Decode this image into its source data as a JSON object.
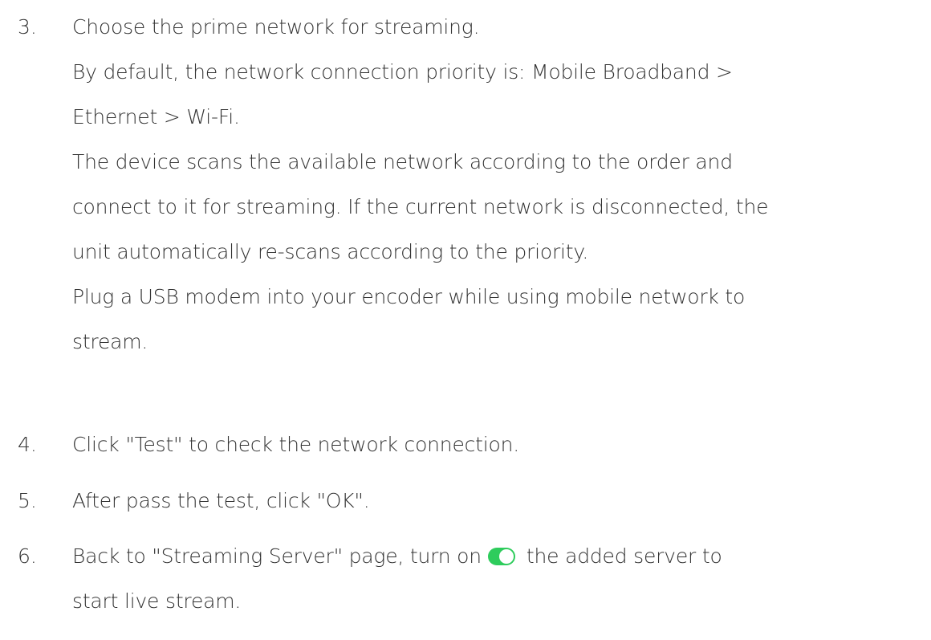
{
  "steps": [
    {
      "number": "3.",
      "lines": [
        "Choose the prime network for streaming.",
        "By default, the network connection priority is: Mobile Broadband >",
        "Ethernet > Wi-Fi.",
        "The device scans the available network according to the order and",
        "connect to it for streaming. If the current network is disconnected, the",
        "unit automatically re-scans according to the priority.",
        "Plug a USB modem into your encoder while using mobile network to",
        "stream."
      ]
    },
    {
      "number": "4.",
      "lines": [
        "Click \"Test\" to check the network connection."
      ]
    },
    {
      "number": "5.",
      "lines": [
        "After pass the test, click \"OK\"."
      ]
    },
    {
      "number": "6.",
      "line1_before_toggle": "Back to \"Streaming Server\" page, turn on",
      "line1_after_toggle": "the added server to",
      "line2": "start live stream.",
      "toggle_icon": "toggle-on-icon",
      "toggle_color": "#2ecc5c"
    }
  ]
}
